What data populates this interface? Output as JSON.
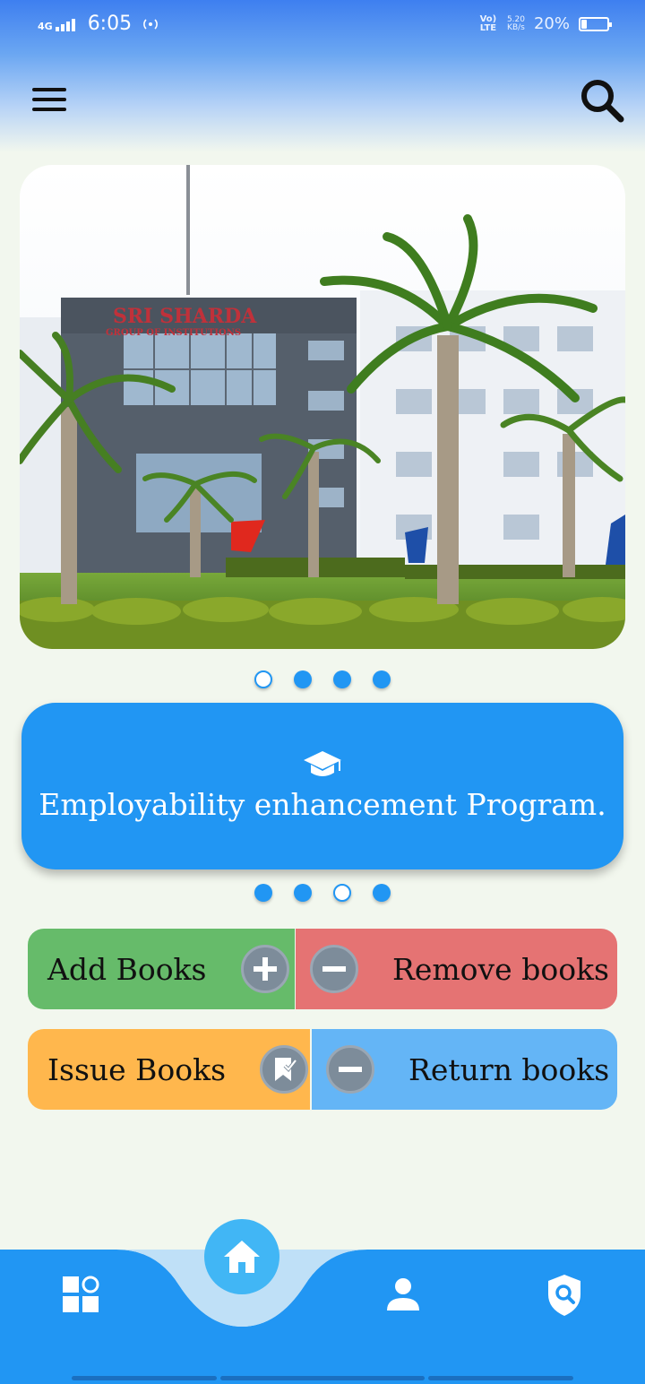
{
  "status_bar": {
    "network": "4G",
    "time": "6:05",
    "volte": "Vo) LTE",
    "speed_value": "5.20",
    "speed_unit": "KB/s",
    "battery_percent": "20%",
    "battery_level": 0.2
  },
  "header": {
    "menu_icon": "hamburger-menu-icon",
    "search_icon": "search-icon"
  },
  "banner": {
    "sign_line1": "SRI SHARDA",
    "sign_line2": "GROUP OF INSTITUTIONS",
    "slide_count": 4,
    "active_slide": 0
  },
  "announcement": {
    "icon": "graduation-cap-icon",
    "text": "Employability enhancement Program.",
    "slide_count": 4,
    "active_slide": 2
  },
  "actions": {
    "add_books": "Add Books",
    "remove_books": "Remove books",
    "issue_books": "Issue Books",
    "return_books": "Return books"
  },
  "colors": {
    "primary": "#2196f3",
    "add": "#66bb6a",
    "remove": "#e57373",
    "issue": "#ffb74d",
    "return": "#64b5f6"
  },
  "bottom_nav": {
    "items": [
      "dashboard-icon",
      "home-icon",
      "profile-icon",
      "security-search-icon"
    ],
    "active": "home-icon"
  }
}
